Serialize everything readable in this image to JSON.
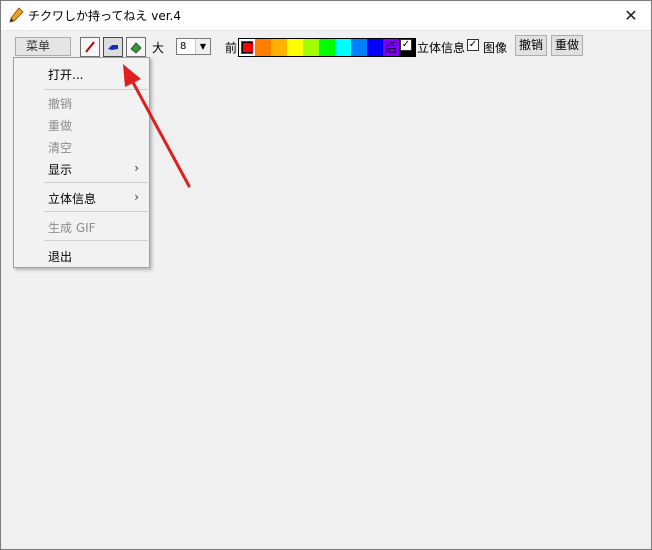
{
  "window": {
    "title": "チクワしか持ってねえ ver.4",
    "close_glyph": "✕"
  },
  "toolbar": {
    "menu_label": "菜单",
    "size_label": "大",
    "size_value": "8",
    "front_label": "前",
    "back_label": "后",
    "stereo_label": "立体信息",
    "image_label": "图像",
    "undo_label": "撤销",
    "redo_label": "重做",
    "check_glyph": "✓",
    "tools": [
      "pencil-icon",
      "hand-icon",
      "eraser-icon"
    ]
  },
  "palette": {
    "colors": [
      "#ff0000",
      "#ff8000",
      "#ffb000",
      "#ffff00",
      "#a0ff00",
      "#00ff00",
      "#00ffff",
      "#0080ff",
      "#0000ff",
      "#8000ff",
      "#000000"
    ],
    "selected_index": 0
  },
  "menu": {
    "items": [
      {
        "label": "打开...",
        "enabled": true
      },
      {
        "label": "撤销",
        "enabled": false
      },
      {
        "label": "重做",
        "enabled": false
      },
      {
        "label": "清空",
        "enabled": false
      },
      {
        "label": "显示",
        "enabled": true,
        "submenu": true
      },
      {
        "label": "立体信息",
        "enabled": true,
        "submenu": true
      },
      {
        "label": "生成 GIF",
        "enabled": false
      },
      {
        "label": "退出",
        "enabled": true
      }
    ],
    "submenu_glyph": "›"
  },
  "colors": {
    "annotation_arrow": "#e02020",
    "window_bg": "#f0f0f0"
  }
}
